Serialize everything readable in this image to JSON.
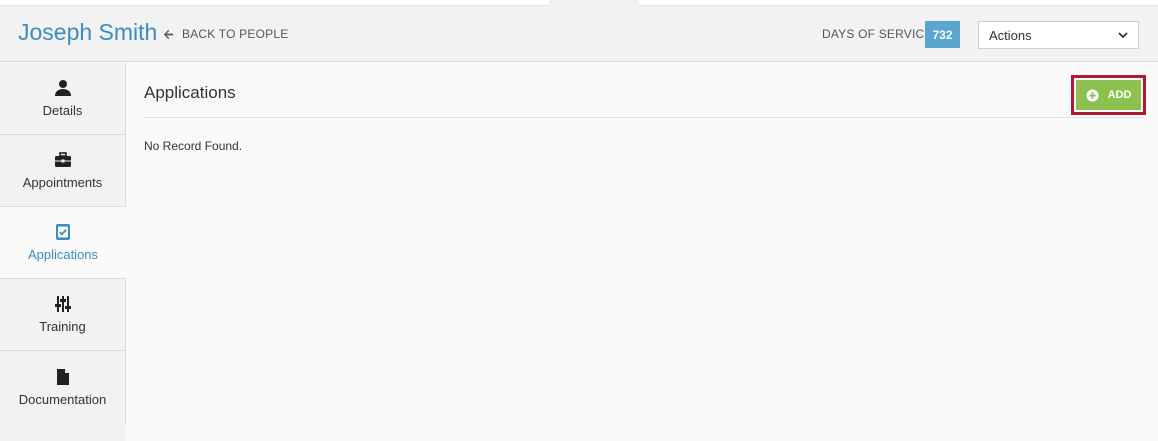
{
  "header": {
    "person_name": "Joseph Smith",
    "back_label": "BACK TO PEOPLE",
    "days_of_service_label": "DAYS OF SERVICE",
    "days_of_service_value": "732",
    "actions_selected": "Actions"
  },
  "sidebar": {
    "items": [
      {
        "label": "Details",
        "icon": "user-icon"
      },
      {
        "label": "Appointments",
        "icon": "briefcase-icon"
      },
      {
        "label": "Applications",
        "icon": "checklist-icon",
        "active": true
      },
      {
        "label": "Training",
        "icon": "sliders-icon"
      },
      {
        "label": "Documentation",
        "icon": "document-icon"
      }
    ]
  },
  "main": {
    "section_title": "Applications",
    "add_label": "ADD",
    "empty_message": "No Record Found."
  },
  "colors": {
    "accent_blue": "#3b8ec2",
    "badge_blue": "#5aa6d1",
    "add_green": "#8cc152",
    "highlight_red": "#b01b30"
  }
}
